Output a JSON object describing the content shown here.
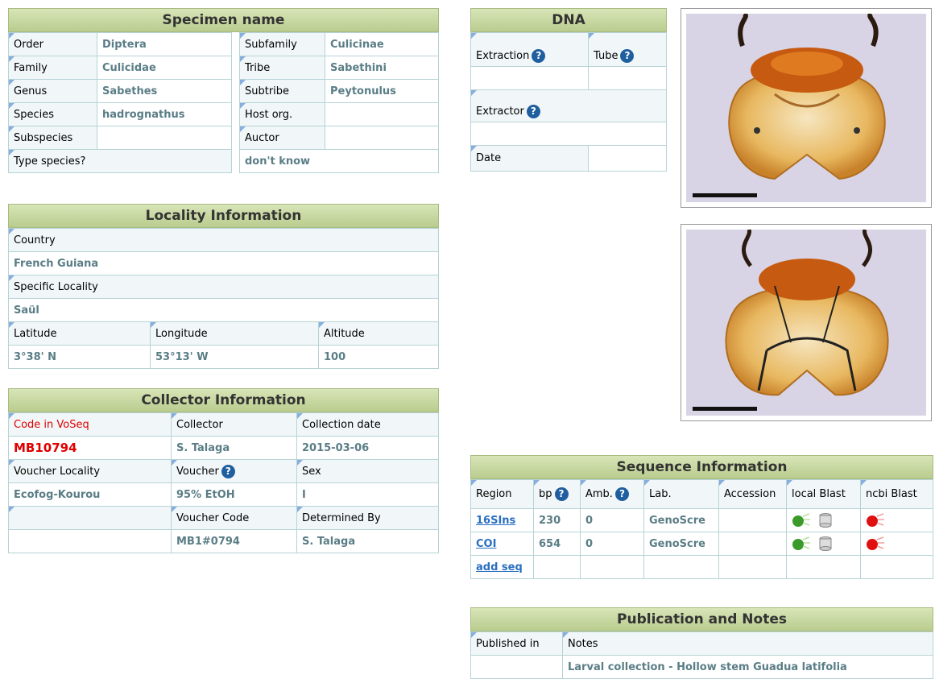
{
  "specimen": {
    "title": "Specimen name",
    "left": [
      {
        "label": "Order",
        "value": "Diptera"
      },
      {
        "label": "Family",
        "value": "Culicidae"
      },
      {
        "label": "Genus",
        "value": "Sabethes"
      },
      {
        "label": "Species",
        "value": "hadrognathus"
      },
      {
        "label": "Subspecies",
        "value": ""
      },
      {
        "label": "Type species?",
        "value": ""
      }
    ],
    "right": [
      {
        "label": "Subfamily",
        "value": "Culicinae"
      },
      {
        "label": "Tribe",
        "value": "Sabethini"
      },
      {
        "label": "Subtribe",
        "value": "Peytonulus"
      },
      {
        "label": "Host org.",
        "value": ""
      },
      {
        "label": "Auctor",
        "value": ""
      }
    ],
    "type_species_value": "don't know"
  },
  "locality": {
    "title": "Locality Information",
    "country_label": "Country",
    "country": "French Guiana",
    "specific_label": "Specific Locality",
    "specific": "Saül",
    "lat_label": "Latitude",
    "lon_label": "Longitude",
    "alt_label": "Altitude",
    "lat": "3°38' N",
    "lon": "53°13' W",
    "alt": "100"
  },
  "collector": {
    "title": "Collector Information",
    "code_label": "Code in VoSeq",
    "collector_label": "Collector",
    "date_label": "Collection date",
    "code": "MB10794",
    "collector": "S. Talaga",
    "date": "2015-03-06",
    "voucher_locality_label": "Voucher Locality",
    "voucher_label": "Voucher",
    "sex_label": "Sex",
    "voucher_locality": "Ecofog-Kourou",
    "voucher": "95% EtOH",
    "sex": "I",
    "voucher_code_label": "Voucher Code",
    "determined_label": "Determined By",
    "voucher_code": "MB1#0794",
    "determined": "S. Talaga"
  },
  "dna": {
    "title": "DNA",
    "extraction_label": "Extraction",
    "tube_label": "Tube",
    "extractor_label": "Extractor",
    "date_label": "Date"
  },
  "sequence": {
    "title": "Sequence Information",
    "headers": [
      "Region",
      "bp",
      "Amb.",
      "Lab.",
      "Accession",
      "local Blast",
      "ncbi Blast"
    ],
    "rows": [
      {
        "region": "16SIns",
        "bp": "230",
        "amb": "0",
        "lab": "GenoScre",
        "accession": ""
      },
      {
        "region": "COI",
        "bp": "654",
        "amb": "0",
        "lab": "GenoScre",
        "accession": ""
      }
    ],
    "add_seq": "add seq"
  },
  "publication": {
    "title": "Publication and Notes",
    "published_label": "Published in",
    "notes_label": "Notes",
    "published": "",
    "notes": "Larval collection - Hollow stem Guadua latifolia"
  },
  "icons": {
    "help": "question-icon",
    "local_blast": "green-blast-icon",
    "database": "database-icon",
    "ncbi_blast": "red-blast-icon"
  },
  "colors": {
    "header_bg": "#c6d6a0",
    "value_text": "#5a7d86",
    "link": "#2a6fc0",
    "code_red": "#e00000"
  }
}
